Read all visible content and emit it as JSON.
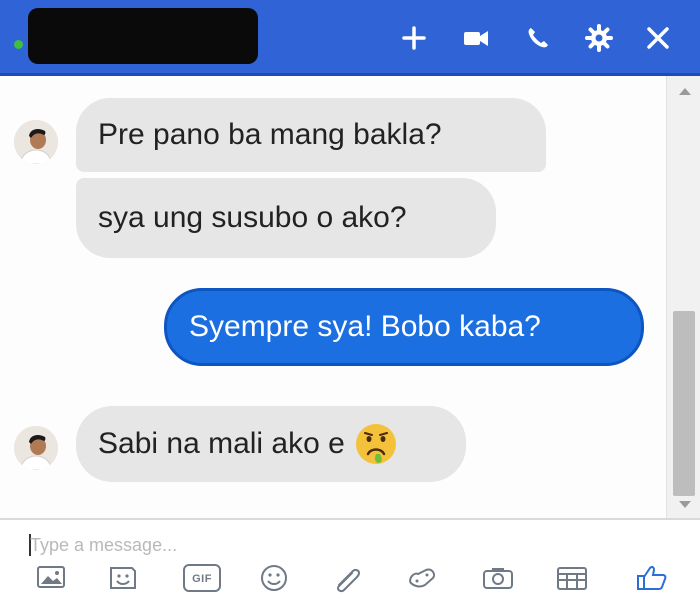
{
  "header": {
    "icons": [
      "add-icon",
      "video-call-icon",
      "phone-icon",
      "settings-icon",
      "close-icon"
    ]
  },
  "messages": [
    {
      "from": "them",
      "text": "Pre pano ba mang bakla?"
    },
    {
      "from": "them",
      "text": "sya ung susubo o ako?"
    },
    {
      "from": "me",
      "text": "Syempre sya! Bobo kaba?"
    },
    {
      "from": "them",
      "text": "Sabi na mali ako e",
      "emoji": "sick-face-emoji"
    }
  ],
  "composer": {
    "placeholder": "Type a message...",
    "gif_label": "GIF",
    "tools": [
      "photo-icon",
      "sticker-icon",
      "gif-icon",
      "emoji-icon",
      "attachment-icon",
      "game-controller-icon",
      "camera-icon",
      "calendar-icon",
      "like-icon"
    ]
  },
  "colors": {
    "header": "#2f63d6",
    "outgoing_bubble": "#1c6fe0",
    "incoming_bubble": "#e6e6e6",
    "icon": "#6f7a86"
  }
}
